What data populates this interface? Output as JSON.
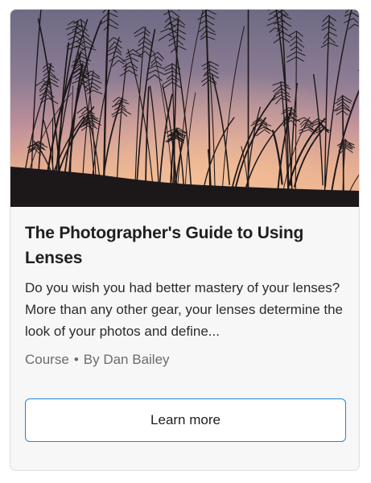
{
  "card": {
    "title": "The Photographer's Guide to Using Lenses",
    "description": "Do you wish you had better mastery of your lenses? More than any other gear, your lenses determine the look of your photos and define...",
    "meta": {
      "type": "Course",
      "separator": "•",
      "author": "By Dan Bailey"
    },
    "button_label": "Learn more",
    "image_icon": "sunset-grass-photo"
  },
  "colors": {
    "accent_border": "#1e88d6",
    "card_bg": "#f7f7f7",
    "title": "#1f1f1f",
    "meta": "#6b6b6b"
  }
}
